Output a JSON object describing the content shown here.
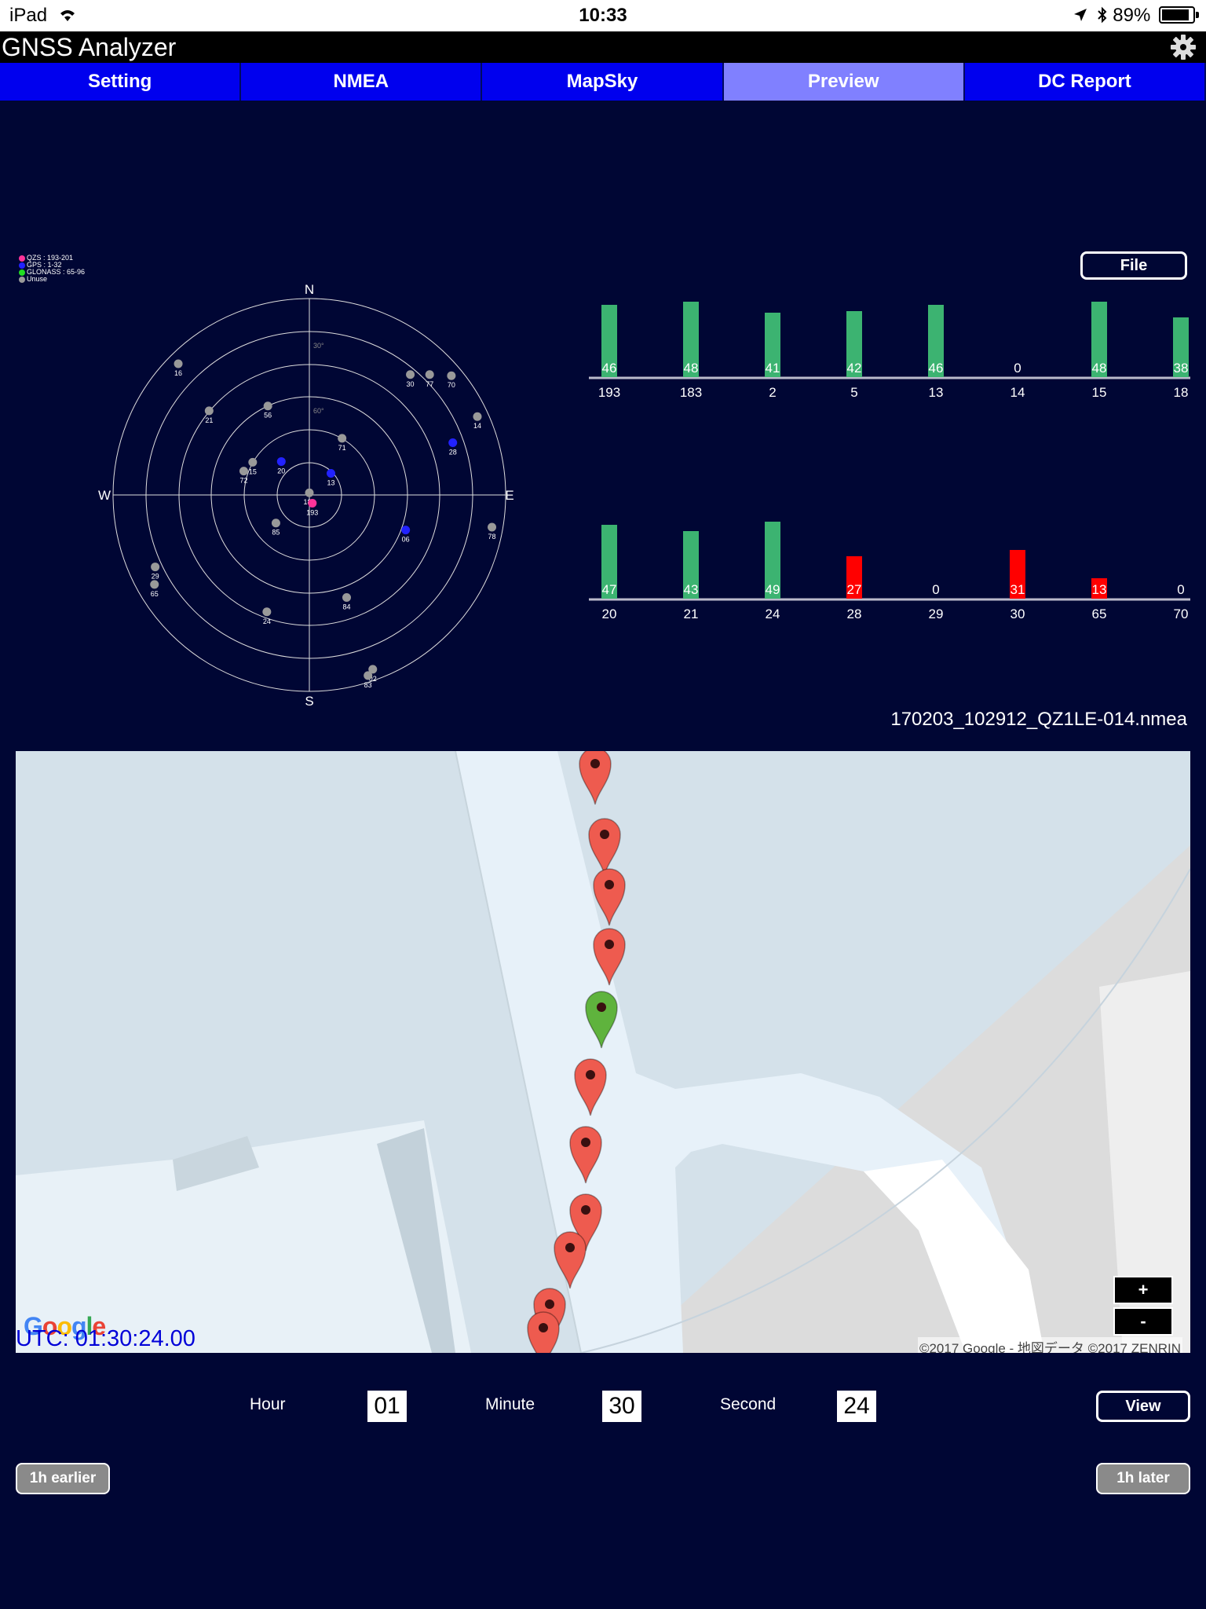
{
  "status_bar": {
    "device": "iPad",
    "time": "10:33",
    "battery": "89%",
    "battery_level": 0.89
  },
  "header": {
    "title": "GNSS Analyzer",
    "settings_icon": "gear-icon"
  },
  "tabs": [
    {
      "label": "Setting",
      "active": false
    },
    {
      "label": "NMEA",
      "active": false
    },
    {
      "label": "MapSky",
      "active": false
    },
    {
      "label": "Preview",
      "active": true
    },
    {
      "label": "DC Report",
      "active": false
    }
  ],
  "skyplot": {
    "legend": [
      {
        "label": "QZS : 193-201",
        "color": "#ff3399"
      },
      {
        "label": "GPS : 1-32",
        "color": "#2222ff"
      },
      {
        "label": "GLONASS : 65-96",
        "color": "#22dd22"
      },
      {
        "label": "Unuse",
        "color": "#999999"
      }
    ],
    "directions": {
      "n": "N",
      "e": "E",
      "s": "S",
      "w": "W"
    },
    "ring_labels": [
      "30°",
      "60°"
    ],
    "colors": {
      "qzs": "#ff3399",
      "gps": "#2222ff",
      "unused": "#999999"
    },
    "satellites": [
      {
        "id": "183",
        "az": 0,
        "el": 89,
        "sys": "unused"
      },
      {
        "id": "30",
        "az": 40,
        "el": 18,
        "sys": "unused"
      },
      {
        "id": "77",
        "az": 45,
        "el": 12,
        "sys": "unused"
      },
      {
        "id": "70",
        "az": 50,
        "el": 5,
        "sys": "unused"
      },
      {
        "id": "14",
        "az": 65,
        "el": 5,
        "sys": "unused"
      },
      {
        "id": "71",
        "az": 30,
        "el": 60,
        "sys": "unused"
      },
      {
        "id": "13",
        "az": 45,
        "el": 76,
        "sys": "gps"
      },
      {
        "id": "28",
        "az": 70,
        "el": 20,
        "sys": "gps"
      },
      {
        "id": "78",
        "az": 100,
        "el": 5,
        "sys": "unused"
      },
      {
        "id": "06",
        "az": 110,
        "el": 43,
        "sys": "gps"
      },
      {
        "id": "193",
        "az": 160,
        "el": 86,
        "sys": "qzs"
      },
      {
        "id": "84",
        "az": 160,
        "el": 40,
        "sys": "unused"
      },
      {
        "id": "02",
        "az": 160,
        "el": 5,
        "sys": "unused"
      },
      {
        "id": "83",
        "az": 162,
        "el": 3,
        "sys": "unused"
      },
      {
        "id": "24",
        "az": 200,
        "el": 33,
        "sys": "unused"
      },
      {
        "id": "85",
        "az": 230,
        "el": 70,
        "sys": "unused"
      },
      {
        "id": "65",
        "az": 240,
        "el": 8,
        "sys": "unused"
      },
      {
        "id": "29",
        "az": 245,
        "el": 12,
        "sys": "unused"
      },
      {
        "id": "72",
        "az": 290,
        "el": 58,
        "sys": "unused"
      },
      {
        "id": "15",
        "az": 300,
        "el": 60,
        "sys": "unused"
      },
      {
        "id": "20",
        "az": 320,
        "el": 70,
        "sys": "gps"
      },
      {
        "id": "21",
        "az": 310,
        "el": 30,
        "sys": "unused"
      },
      {
        "id": "16",
        "az": 315,
        "el": 5,
        "sys": "unused"
      },
      {
        "id": "56",
        "az": 335,
        "el": 45,
        "sys": "unused"
      }
    ]
  },
  "file_button": {
    "label": "File"
  },
  "chart_data": [
    {
      "type": "bar",
      "categories": [
        "193",
        "183",
        "2",
        "5",
        "13",
        "14",
        "15",
        "18"
      ],
      "values": [
        46,
        48,
        41,
        42,
        46,
        0,
        48,
        38
      ],
      "colors": [
        "#3cb371",
        "#3cb371",
        "#3cb371",
        "#3cb371",
        "#3cb371",
        "#3cb371",
        "#3cb371",
        "#3cb371"
      ],
      "ylim": [
        0,
        50
      ]
    },
    {
      "type": "bar",
      "categories": [
        "20",
        "21",
        "24",
        "28",
        "29",
        "30",
        "65",
        "70"
      ],
      "values": [
        47,
        43,
        49,
        27,
        0,
        31,
        13,
        0
      ],
      "colors": [
        "#3cb371",
        "#3cb371",
        "#3cb371",
        "#ff0000",
        "#3cb371",
        "#ff0000",
        "#ff0000",
        "#3cb371"
      ],
      "ylim": [
        0,
        50
      ]
    }
  ],
  "filename": "170203_102912_QZ1LE-014.nmea",
  "map": {
    "utc": "UTC: 01:30:24.00",
    "attribution": "©2017 Google - 地図データ ©2017 ZENRIN",
    "google_logo": "Google",
    "zoom_in": "+",
    "zoom_out": "-",
    "marker_icon": "map-pin-icon",
    "current_marker_color": "#5fb33d",
    "other_marker_color": "#ee5b4f"
  },
  "time_controls": {
    "hour_label": "Hour",
    "hour": "01",
    "minute_label": "Minute",
    "minute": "30",
    "second_label": "Second",
    "second": "24",
    "view_button": "View"
  },
  "nav": {
    "earlier": "1h earlier",
    "later": "1h later"
  }
}
